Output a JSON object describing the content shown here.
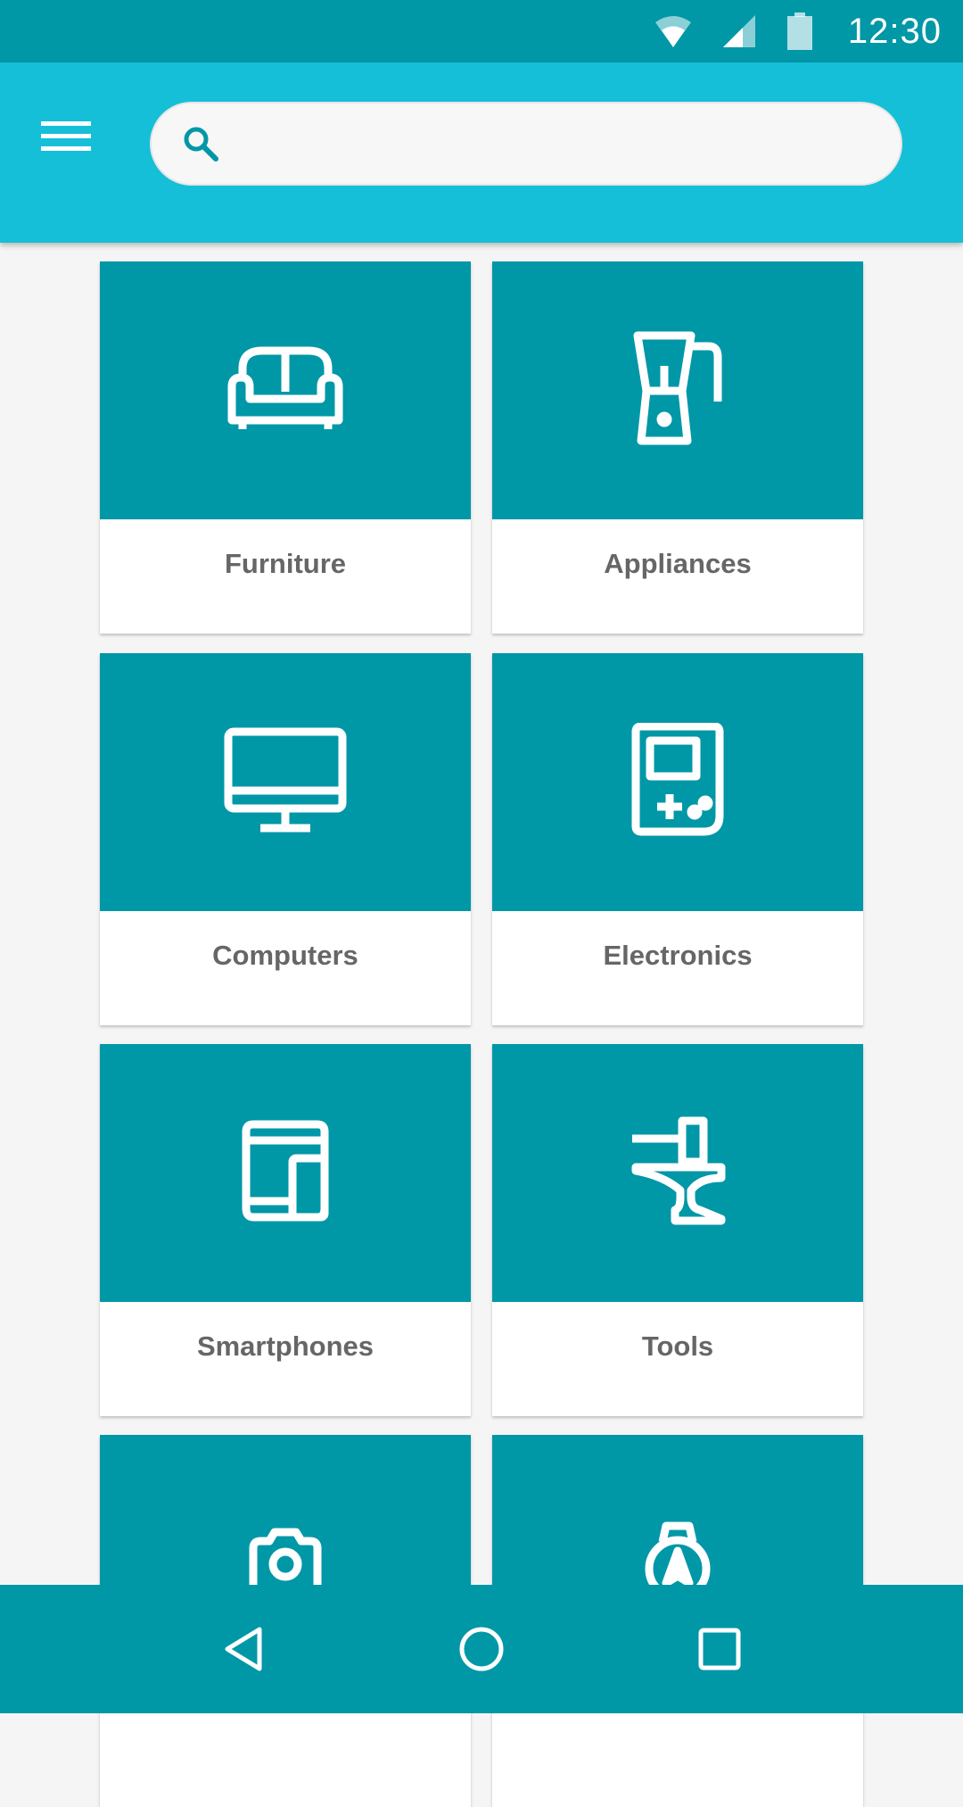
{
  "status_bar": {
    "time": "12:30",
    "icons": [
      "wifi-icon",
      "cell-signal-icon",
      "battery-icon"
    ]
  },
  "app_bar": {
    "menu_icon": "hamburger-menu-icon",
    "search": {
      "icon": "search-icon",
      "value": "",
      "placeholder": ""
    }
  },
  "categories": [
    {
      "label": "Furniture",
      "icon": "sofa-icon"
    },
    {
      "label": "Appliances",
      "icon": "blender-icon"
    },
    {
      "label": "Computers",
      "icon": "desktop-monitor-icon"
    },
    {
      "label": "Electronics",
      "icon": "handheld-game-icon"
    },
    {
      "label": "Smartphones",
      "icon": "devices-icon"
    },
    {
      "label": "Tools",
      "icon": "anvil-hammer-icon"
    },
    {
      "label": "",
      "icon": "camera-icon"
    },
    {
      "label": "",
      "icon": "compass-icon"
    }
  ],
  "nav_bar": {
    "buttons": [
      "back-icon",
      "home-icon",
      "recents-icon"
    ]
  },
  "colors": {
    "status_bar": "#0097a7",
    "app_bar": "#15bfd8",
    "tile": "#0097a7",
    "background": "#f5f5f5",
    "label_text": "#666666"
  }
}
